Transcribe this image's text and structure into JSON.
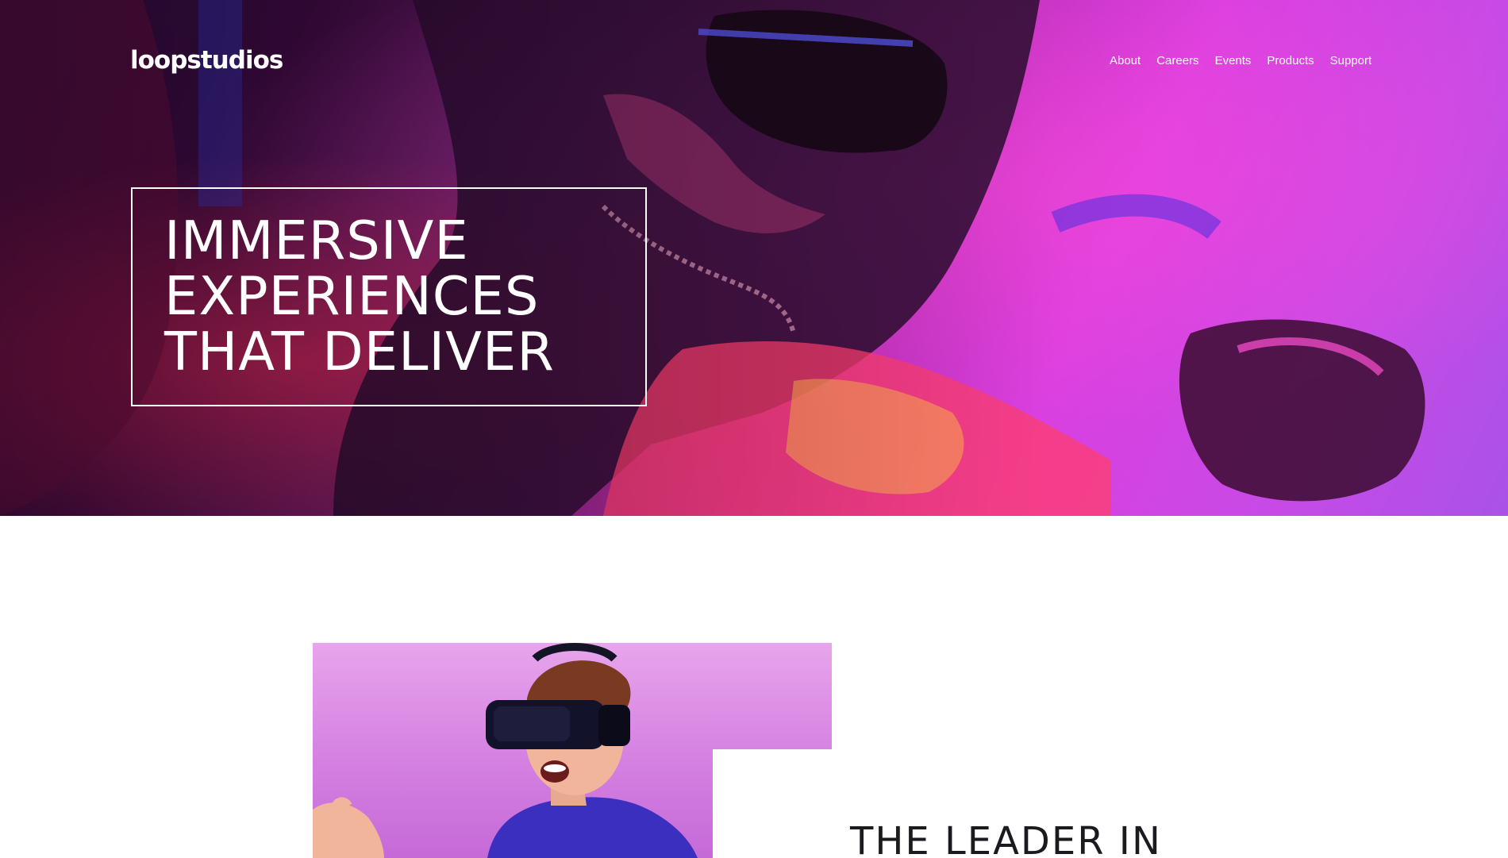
{
  "brand": {
    "logo_text": "loopstudios"
  },
  "nav": {
    "items": [
      "About",
      "Careers",
      "Events",
      "Products",
      "Support"
    ]
  },
  "hero": {
    "title_lines": [
      "IMMERSIVE",
      "EXPERIENCES",
      "THAT DELIVER"
    ]
  },
  "intro": {
    "heading_lines": [
      "THE LEADER IN"
    ]
  },
  "colors": {
    "hero_pink": "#e23be6",
    "hero_purple": "#a952e8",
    "hero_dark": "#2a0f3a",
    "text_dark": "#1b1b1f",
    "white": "#ffffff"
  }
}
